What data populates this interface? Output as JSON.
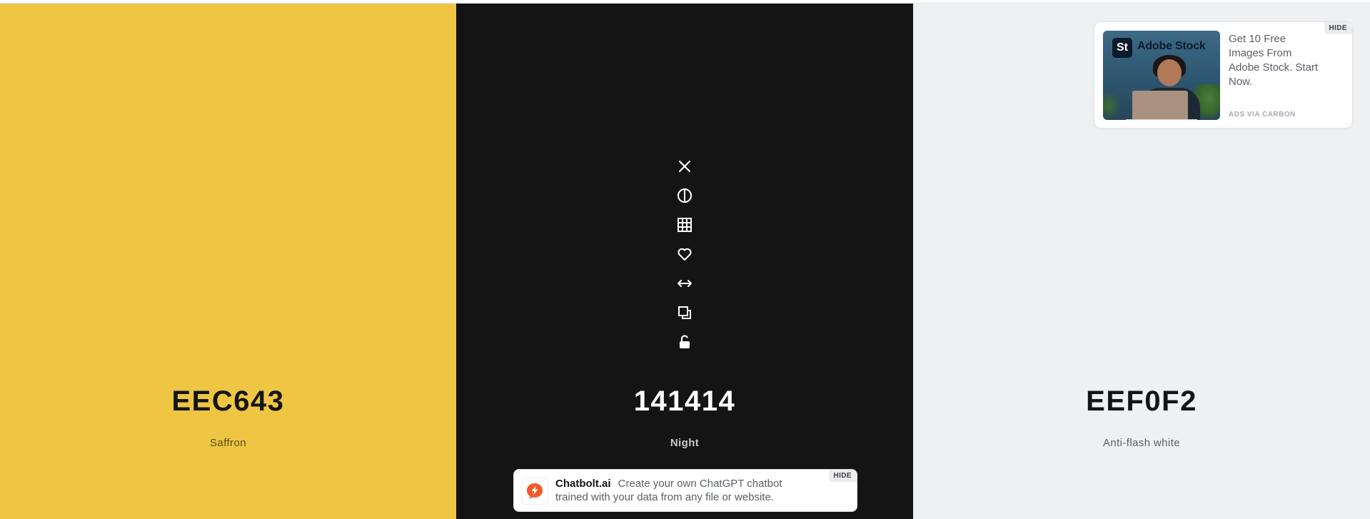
{
  "palette": {
    "colors": [
      {
        "hex": "EEC643",
        "name": "Saffron",
        "bg": "#EEC643",
        "hex_color": "#141414",
        "name_color": "#5a4a1a"
      },
      {
        "hex": "141414",
        "name": "Night",
        "bg": "#141414",
        "hex_color": "#FFFFFF",
        "name_color": "#c8c8c8"
      },
      {
        "hex": "EEF0F2",
        "name": "Anti-flash white",
        "bg": "#EEF0F2",
        "hex_color": "#141414",
        "name_color": "#5a5e66"
      }
    ]
  },
  "tools": [
    {
      "name": "remove-color",
      "icon": "close-icon"
    },
    {
      "name": "view-shades",
      "icon": "half-circle-icon"
    },
    {
      "name": "grid",
      "icon": "grid-icon"
    },
    {
      "name": "favorite",
      "icon": "heart-icon"
    },
    {
      "name": "drag",
      "icon": "arrows-horizontal-icon"
    },
    {
      "name": "copy",
      "icon": "copy-icon"
    },
    {
      "name": "lock",
      "icon": "unlock-icon"
    }
  ],
  "carbon_ad": {
    "logo_letters": "St",
    "brand": "Adobe Stock",
    "text": "Get 10 Free Images From Adobe Stock. Start Now.",
    "via": "ADS VIA CARBON",
    "hide_label": "HIDE"
  },
  "banner": {
    "brand": "Chatbolt.ai",
    "text": "Create your own ChatGPT chatbot trained with your data from any file or website.",
    "hide_label": "HIDE",
    "accent": "#F05A28"
  }
}
